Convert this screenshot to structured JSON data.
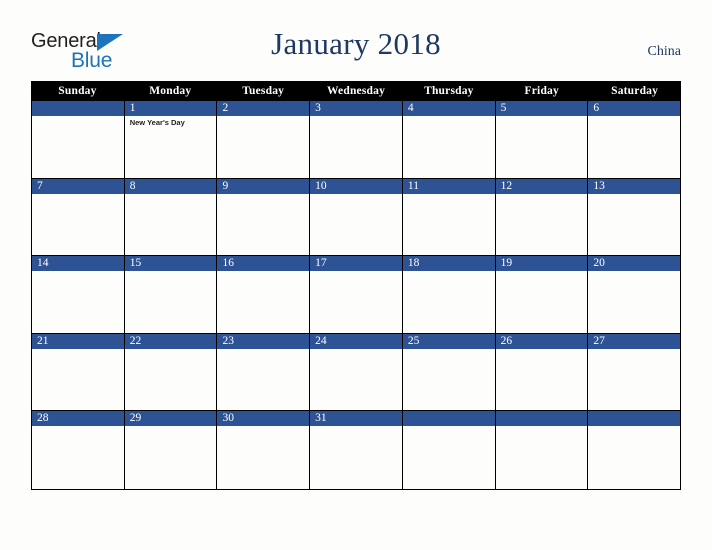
{
  "branding": {
    "logo_word_one": "General",
    "logo_word_two": "Blue",
    "logo_accent_color": "#1c75bc",
    "logo_text_color": "#231f20"
  },
  "header": {
    "title": "January 2018",
    "country": "China",
    "title_color": "#1f3864"
  },
  "theme": {
    "page_background": "#fdfdfb",
    "weekday_header_background": "#000000",
    "weekday_header_text": "#ffffff",
    "day_number_background": "#2e5395",
    "day_number_text": "#ffffff",
    "grid_line_color": "#000000",
    "cell_background": "#fdfdfb",
    "event_text_color": "#231f20"
  },
  "calendar": {
    "month": "January",
    "year": "2018",
    "weekday_headers": [
      "Sunday",
      "Monday",
      "Tuesday",
      "Wednesday",
      "Thursday",
      "Friday",
      "Saturday"
    ],
    "weeks": [
      [
        {
          "day": "",
          "events": []
        },
        {
          "day": "1",
          "events": [
            "New Year's Day"
          ]
        },
        {
          "day": "2",
          "events": []
        },
        {
          "day": "3",
          "events": []
        },
        {
          "day": "4",
          "events": []
        },
        {
          "day": "5",
          "events": []
        },
        {
          "day": "6",
          "events": []
        }
      ],
      [
        {
          "day": "7",
          "events": []
        },
        {
          "day": "8",
          "events": []
        },
        {
          "day": "9",
          "events": []
        },
        {
          "day": "10",
          "events": []
        },
        {
          "day": "11",
          "events": []
        },
        {
          "day": "12",
          "events": []
        },
        {
          "day": "13",
          "events": []
        }
      ],
      [
        {
          "day": "14",
          "events": []
        },
        {
          "day": "15",
          "events": []
        },
        {
          "day": "16",
          "events": []
        },
        {
          "day": "17",
          "events": []
        },
        {
          "day": "18",
          "events": []
        },
        {
          "day": "19",
          "events": []
        },
        {
          "day": "20",
          "events": []
        }
      ],
      [
        {
          "day": "21",
          "events": []
        },
        {
          "day": "22",
          "events": []
        },
        {
          "day": "23",
          "events": []
        },
        {
          "day": "24",
          "events": []
        },
        {
          "day": "25",
          "events": []
        },
        {
          "day": "26",
          "events": []
        },
        {
          "day": "27",
          "events": []
        }
      ],
      [
        {
          "day": "28",
          "events": []
        },
        {
          "day": "29",
          "events": []
        },
        {
          "day": "30",
          "events": []
        },
        {
          "day": "31",
          "events": []
        },
        {
          "day": "",
          "events": []
        },
        {
          "day": "",
          "events": []
        },
        {
          "day": "",
          "events": []
        }
      ]
    ]
  }
}
